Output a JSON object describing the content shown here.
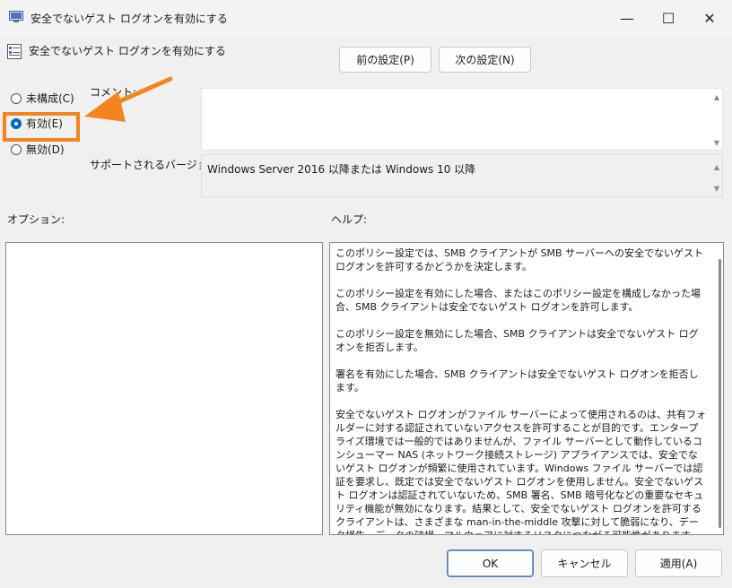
{
  "window": {
    "title": "安全でないゲスト ログオンを有効にする",
    "controls": {
      "minimize": "—",
      "maximize": "☐",
      "close": "✕"
    }
  },
  "header": {
    "setting_title": "安全でないゲスト ログオンを有効にする",
    "prev_button": "前の設定(P)",
    "next_button": "次の設定(N)"
  },
  "state_options": [
    {
      "label": "未構成(C)",
      "selected": false
    },
    {
      "label": "有効(E)",
      "selected": true
    },
    {
      "label": "無効(D)",
      "selected": false
    }
  ],
  "comment": {
    "label": "コメント:",
    "value": ""
  },
  "supported_on": {
    "label": "サポートされるバージョン:",
    "value": "Windows Server 2016 以降または Windows 10 以降"
  },
  "options_section": {
    "label": "オプション:"
  },
  "help_section": {
    "label": "ヘルプ:",
    "paragraphs": [
      "このポリシー設定では、SMB クライアントが SMB サーバーへの安全でないゲスト ログオンを許可するかどうかを決定します。",
      "このポリシー設定を有効にした場合、またはこのポリシー設定を構成しなかった場合、SMB クライアントは安全でないゲスト ログオンを許可します。",
      "このポリシー設定を無効にした場合、SMB クライアントは安全でないゲスト ログオンを拒否します。",
      "署名を有効にした場合、SMB クライアントは安全でないゲスト ログオンを拒否します。",
      "安全でないゲスト ログオンがファイル サーバーによって使用されるのは、共有フォルダーに対する認証されていないアクセスを許可することが目的です。エンタープライズ環境では一般的ではありませんが、ファイル サーバーとして動作しているコンシューマー NAS (ネットワーク接続ストレージ) アプライアンスでは、安全でないゲスト ログオンが頻繁に使用されています。Windows ファイル サーバーでは認証を要求し、既定では安全でないゲスト ログオンを使用しません。安全でないゲスト ログオンは認証されていないため、SMB 署名、SMB 暗号化などの重要なセキュリティ機能が無効になります。結果として、安全でないゲスト ログオンを許可するクライアントは、さまざまな man-in-the-middle 攻撃に対して脆弱になり、データ損失、データの破損、マルウェアに対するリスクにつながる可能性があります。また、安全でないゲスト ログオンを使用してファイル サーバーに書き込まれたデータは、ネットワーク上のすべてのユーザーからアクセスできる可能性があります。Microsoft では、安全でないゲスト ロ"
    ]
  },
  "footer": {
    "ok": "OK",
    "cancel": "キャンセル",
    "apply": "適用(A)"
  },
  "annotation": {
    "color": "#f5841f"
  }
}
